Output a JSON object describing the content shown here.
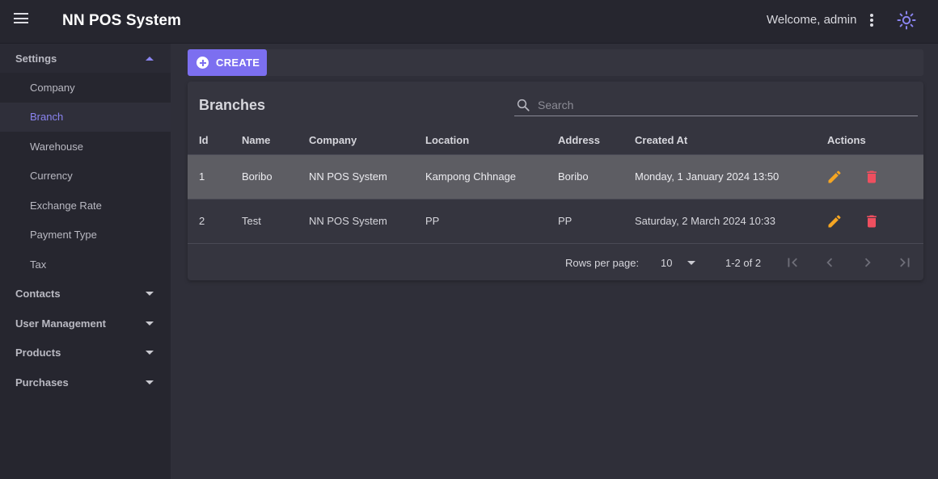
{
  "app": {
    "title": "NN POS System",
    "welcome": "Welcome, admin"
  },
  "sidebar": {
    "settings": {
      "label": "Settings",
      "expanded": true
    },
    "settings_items": [
      {
        "label": "Company"
      },
      {
        "label": "Branch",
        "active": true
      },
      {
        "label": "Warehouse"
      },
      {
        "label": "Currency"
      },
      {
        "label": "Exchange Rate"
      },
      {
        "label": "Payment Type"
      },
      {
        "label": "Tax"
      }
    ],
    "groups": [
      {
        "label": "Contacts"
      },
      {
        "label": "User Management"
      },
      {
        "label": "Products"
      },
      {
        "label": "Purchases"
      }
    ]
  },
  "toolbar": {
    "create_label": "CREATE"
  },
  "table": {
    "title": "Branches",
    "search_placeholder": "Search",
    "columns": [
      "Id",
      "Name",
      "Company",
      "Location",
      "Address",
      "Created At",
      "Actions"
    ],
    "rows": [
      {
        "id": "1",
        "name": "Boribo",
        "company": "NN POS System",
        "location": "Kampong Chhnage",
        "address": "Boribo",
        "created_at": "Monday, 1 January 2024 13:50"
      },
      {
        "id": "2",
        "name": "Test",
        "company": "NN POS System",
        "location": "PP",
        "address": "PP",
        "created_at": "Saturday, 2 March 2024 10:33"
      }
    ],
    "rows_per_page_label": "Rows per page:",
    "rows_per_page": "10",
    "range_text": "1-2 of 2"
  },
  "colors": {
    "accent": "#7c6ff0",
    "edit": "#f5a623",
    "delete": "#ef4f5f",
    "topbar": "#26262f",
    "background": "#2f2f39"
  },
  "icons": {
    "menu": "menu-icon",
    "more": "more-vert-icon",
    "theme": "sun-icon",
    "create": "plus-circle-icon",
    "search": "search-icon",
    "edit": "pencil-icon",
    "delete": "trash-icon"
  }
}
